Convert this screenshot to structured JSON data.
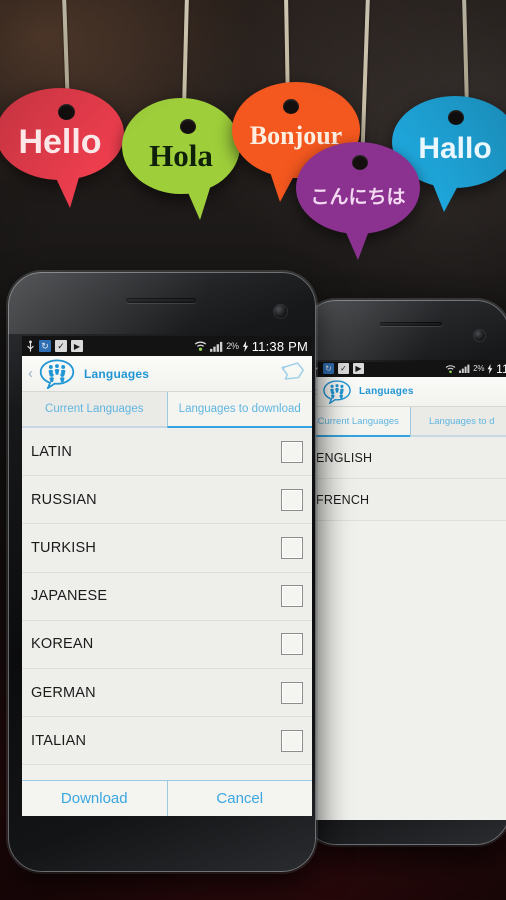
{
  "background": {
    "scene_name": "hanging-speech-bubble-tags",
    "bubbles": [
      {
        "text": "Hello",
        "color": "#ee3e4e",
        "text_color": "#fbe6e8"
      },
      {
        "text": "Hola",
        "color": "#9ece3a",
        "text_color": "#10210a"
      },
      {
        "text": "Bonjour",
        "color": "#f4581f",
        "text_color": "#fdeee2"
      },
      {
        "text": "こんにちは",
        "color": "#8b3290",
        "text_color": "#f4d9f2"
      },
      {
        "text": "Hallo",
        "color": "#1fa8dd",
        "text_color": "#eaf7fd"
      }
    ]
  },
  "phone_front": {
    "statusbar": {
      "icons": [
        "usb-icon",
        "sync-icon",
        "checkbox-app-icon",
        "play-store-icon"
      ],
      "wifi_icon": "wifi-icon",
      "signal_icon": "signal-bars-icon",
      "battery_percent": "2%",
      "charging_icon": "charging-bolt-icon",
      "time": "11:38 PM"
    },
    "actionbar": {
      "back_icon": "back-caret-icon",
      "logo_icon": "languages-logo-icon",
      "title": "Languages",
      "action_icon": "speech-tag-icon"
    },
    "tabs": [
      {
        "label": "Current Languages",
        "selected": false
      },
      {
        "label": "Languages to download",
        "selected": true
      }
    ],
    "list": {
      "checkbox_icon": "checkbox-icon",
      "rows": [
        {
          "label": "LATIN",
          "checked": false
        },
        {
          "label": "RUSSIAN",
          "checked": false
        },
        {
          "label": "TURKISH",
          "checked": false
        },
        {
          "label": "JAPANESE",
          "checked": false
        },
        {
          "label": "KOREAN",
          "checked": false
        },
        {
          "label": "GERMAN",
          "checked": false
        },
        {
          "label": "ITALIAN",
          "checked": false
        }
      ]
    },
    "footer": {
      "download_label": "Download",
      "cancel_label": "Cancel"
    }
  },
  "phone_back": {
    "statusbar": {
      "icons": [
        "usb-icon",
        "sync-icon",
        "checkbox-app-icon",
        "play-store-icon"
      ],
      "wifi_icon": "wifi-icon",
      "signal_icon": "signal-bars-icon",
      "battery_percent": "2%",
      "charging_icon": "charging-bolt-icon",
      "time": "11"
    },
    "actionbar": {
      "back_icon": "back-caret-icon",
      "logo_icon": "languages-logo-icon",
      "title": "Languages"
    },
    "tabs": [
      {
        "label": "Current Languages",
        "selected": true
      },
      {
        "label": "Languages to d",
        "selected": false
      }
    ],
    "list": {
      "rows": [
        {
          "label": "ENGLISH"
        },
        {
          "label": "FRENCH"
        }
      ]
    }
  },
  "colors": {
    "accent_blue": "#2196d4",
    "link_blue": "#3aa7e0",
    "tab_blue": "#5fb6e0",
    "screen_bg": "#eeeeea",
    "statusbar_bg": "#131313"
  }
}
